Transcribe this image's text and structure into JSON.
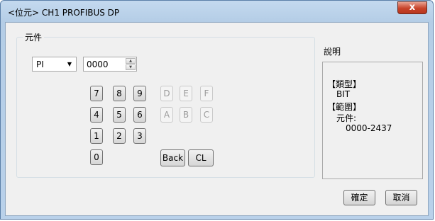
{
  "window": {
    "title": "<位元> CH1 PROFIBUS DP",
    "close_glyph": "x"
  },
  "device": {
    "group_label": "元件",
    "type_selected": "PI",
    "address_value": "0000",
    "dropdown_icon": "triangle-down",
    "keypad": {
      "row1": [
        "7",
        "8",
        "9",
        "D",
        "E",
        "F"
      ],
      "row2": [
        "4",
        "5",
        "6",
        "A",
        "B",
        "C"
      ],
      "row3": [
        "1",
        "2",
        "3"
      ],
      "row4": [
        "0"
      ],
      "back_label": "Back",
      "clear_label": "CL"
    }
  },
  "description": {
    "title": "說明",
    "type_header": "【類型】",
    "type_value": "BIT",
    "range_header": "【範圍】",
    "range_sub": "元件:",
    "range_value": "0000-2437"
  },
  "footer": {
    "ok_label": "確定",
    "cancel_label": "取消"
  }
}
